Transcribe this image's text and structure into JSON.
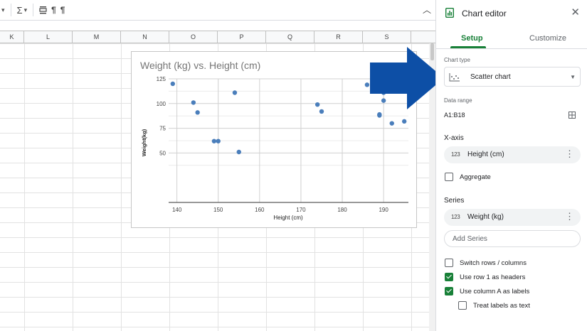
{
  "toolbar": {
    "sigma": "Σ",
    "pilcrow1": "¶",
    "pilcrow2": "¶"
  },
  "columns": [
    "K",
    "L",
    "M",
    "N",
    "O",
    "P",
    "Q",
    "R",
    "S"
  ],
  "chart": {
    "chart_data": {
      "type": "scatter",
      "title": "Weight (kg) vs. Height (cm)",
      "xlabel": "Height (cm)",
      "ylabel": "Weight(kg)",
      "xlim": [
        138,
        196
      ],
      "ylim": [
        0,
        125
      ],
      "x_ticks": [
        140,
        150,
        160,
        170,
        180,
        190
      ],
      "y_ticks": [
        50,
        75,
        100,
        125
      ],
      "grid": true,
      "point_color": "#4a7ebb",
      "points": [
        {
          "x": 139,
          "y": 120
        },
        {
          "x": 144,
          "y": 101
        },
        {
          "x": 145,
          "y": 91
        },
        {
          "x": 149,
          "y": 62
        },
        {
          "x": 150,
          "y": 62
        },
        {
          "x": 154,
          "y": 111
        },
        {
          "x": 155,
          "y": 51
        },
        {
          "x": 174,
          "y": 99
        },
        {
          "x": 175,
          "y": 92
        },
        {
          "x": 186,
          "y": 119
        },
        {
          "x": 189,
          "y": 89
        },
        {
          "x": 189,
          "y": 88
        },
        {
          "x": 190,
          "y": 111
        },
        {
          "x": 190,
          "y": 103
        },
        {
          "x": 192,
          "y": 80
        },
        {
          "x": 195,
          "y": 82
        }
      ]
    }
  },
  "editor": {
    "title": "Chart editor",
    "tabs": {
      "setup": "Setup",
      "customize": "Customize"
    },
    "chart_type_label": "Chart type",
    "chart_type_value": "Scatter chart",
    "data_range_label": "Data range",
    "data_range_value": "A1:B18",
    "x_axis_heading": "X-axis",
    "x_axis_chip": "Height (cm)",
    "num_icon": "123",
    "aggregate_label": "Aggregate",
    "series_heading": "Series",
    "series_chip": "Weight (kg)",
    "add_series": "Add Series",
    "switch_rows": "Switch rows / columns",
    "use_row1": "Use row 1 as headers",
    "use_colA": "Use column A as labels",
    "treat_labels": "Treat labels as text",
    "checkboxes": {
      "aggregate": false,
      "switch_rows": false,
      "use_row1": true,
      "use_colA": true,
      "treat_labels": false
    },
    "accent_color": "#188038"
  },
  "arrow_color": "#0d4fa6"
}
